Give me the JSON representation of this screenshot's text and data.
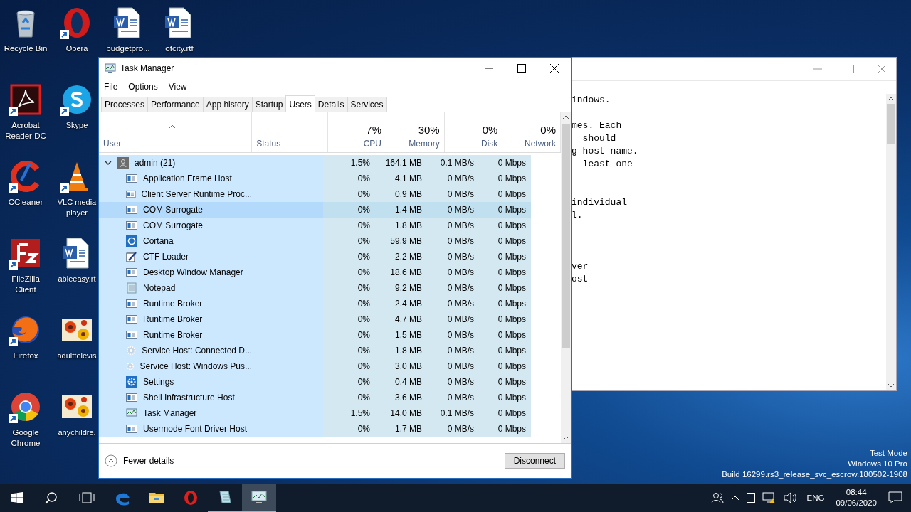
{
  "desktop_icons": [
    {
      "label": "Recycle Bin",
      "kind": "recycle",
      "shortcut": false
    },
    {
      "label": "Acrobat Reader DC",
      "kind": "acrobat",
      "shortcut": true
    },
    {
      "label": "CCleaner",
      "kind": "ccleaner",
      "shortcut": true
    },
    {
      "label": "FileZilla Client",
      "kind": "filezilla",
      "shortcut": true
    },
    {
      "label": "Firefox",
      "kind": "firefox",
      "shortcut": true
    },
    {
      "label": "Google Chrome",
      "kind": "chrome",
      "shortcut": true
    },
    {
      "label": "Opera",
      "kind": "opera",
      "shortcut": true
    },
    {
      "label": "Skype",
      "kind": "skype",
      "shortcut": true
    },
    {
      "label": "VLC media player",
      "kind": "vlc",
      "shortcut": true
    },
    {
      "label": "ableeasy.rt",
      "kind": "document",
      "shortcut": false
    },
    {
      "label": "adulttelevis",
      "kind": "image",
      "shortcut": false
    },
    {
      "label": "anychildre.",
      "kind": "image",
      "shortcut": false
    },
    {
      "label": "budgetpro...",
      "kind": "document",
      "shortcut": false
    },
    {
      "label": "ofcity.rtf",
      "kind": "document",
      "shortcut": false
    }
  ],
  "notepad_window": {
    "text": "indows.\n\nmes. Each\n  should\ng host name.\n  least one\n\n\nindividual\nl.\n\n\n\nver\nost"
  },
  "task_manager": {
    "title": "Task Manager",
    "menu": [
      "File",
      "Options",
      "View"
    ],
    "tabs": [
      {
        "label": "Processes",
        "selected": false
      },
      {
        "label": "Performance",
        "selected": false
      },
      {
        "label": "App history",
        "selected": false
      },
      {
        "label": "Startup",
        "selected": false
      },
      {
        "label": "Users",
        "selected": true
      },
      {
        "label": "Details",
        "selected": false
      },
      {
        "label": "Services",
        "selected": false
      }
    ],
    "columns": [
      {
        "label": "User"
      },
      {
        "label": "Status"
      },
      {
        "percent": "7%",
        "label": "CPU"
      },
      {
        "percent": "30%",
        "label": "Memory"
      },
      {
        "percent": "0%",
        "label": "Disk"
      },
      {
        "percent": "0%",
        "label": "Network"
      }
    ],
    "group": {
      "name": "admin (21)",
      "expanded": true,
      "cpu": "1.5%",
      "memory": "164.1 MB",
      "disk": "0.1 MB/s",
      "network": "0 Mbps"
    },
    "rows": [
      {
        "kind": "app",
        "name": "Application Frame Host",
        "cpu": "0%",
        "memory": "4.1 MB",
        "disk": "0 MB/s",
        "network": "0 Mbps",
        "selected": false
      },
      {
        "kind": "app",
        "name": "Client Server Runtime Proc...",
        "cpu": "0%",
        "memory": "0.9 MB",
        "disk": "0 MB/s",
        "network": "0 Mbps",
        "selected": false
      },
      {
        "kind": "app",
        "name": "COM Surrogate",
        "cpu": "0%",
        "memory": "1.4 MB",
        "disk": "0 MB/s",
        "network": "0 Mbps",
        "selected": true
      },
      {
        "kind": "app",
        "name": "COM Surrogate",
        "cpu": "0%",
        "memory": "1.8 MB",
        "disk": "0 MB/s",
        "network": "0 Mbps",
        "selected": false
      },
      {
        "kind": "cortana",
        "name": "Cortana",
        "cpu": "0%",
        "memory": "59.9 MB",
        "disk": "0 MB/s",
        "network": "0 Mbps",
        "selected": false
      },
      {
        "kind": "ctf",
        "name": "CTF Loader",
        "cpu": "0%",
        "memory": "2.2 MB",
        "disk": "0 MB/s",
        "network": "0 Mbps",
        "selected": false
      },
      {
        "kind": "app",
        "name": "Desktop Window Manager",
        "cpu": "0%",
        "memory": "18.6 MB",
        "disk": "0 MB/s",
        "network": "0 Mbps",
        "selected": false
      },
      {
        "kind": "notepad",
        "name": "Notepad",
        "cpu": "0%",
        "memory": "9.2 MB",
        "disk": "0 MB/s",
        "network": "0 Mbps",
        "selected": false
      },
      {
        "kind": "app",
        "name": "Runtime Broker",
        "cpu": "0%",
        "memory": "2.4 MB",
        "disk": "0 MB/s",
        "network": "0 Mbps",
        "selected": false
      },
      {
        "kind": "app",
        "name": "Runtime Broker",
        "cpu": "0%",
        "memory": "4.7 MB",
        "disk": "0 MB/s",
        "network": "0 Mbps",
        "selected": false
      },
      {
        "kind": "app",
        "name": "Runtime Broker",
        "cpu": "0%",
        "memory": "1.5 MB",
        "disk": "0 MB/s",
        "network": "0 Mbps",
        "selected": false
      },
      {
        "kind": "service",
        "name": "Service Host: Connected D...",
        "cpu": "0%",
        "memory": "1.8 MB",
        "disk": "0 MB/s",
        "network": "0 Mbps",
        "selected": false
      },
      {
        "kind": "service",
        "name": "Service Host: Windows Pus...",
        "cpu": "0%",
        "memory": "3.0 MB",
        "disk": "0 MB/s",
        "network": "0 Mbps",
        "selected": false
      },
      {
        "kind": "settings",
        "name": "Settings",
        "cpu": "0%",
        "memory": "0.4 MB",
        "disk": "0 MB/s",
        "network": "0 Mbps",
        "selected": false
      },
      {
        "kind": "app",
        "name": "Shell Infrastructure Host",
        "cpu": "0%",
        "memory": "3.6 MB",
        "disk": "0 MB/s",
        "network": "0 Mbps",
        "selected": false
      },
      {
        "kind": "taskmgr",
        "name": "Task Manager",
        "cpu": "1.5%",
        "memory": "14.0 MB",
        "disk": "0.1 MB/s",
        "network": "0 Mbps",
        "selected": false
      },
      {
        "kind": "app",
        "name": "Usermode Font Driver Host",
        "cpu": "0%",
        "memory": "1.7 MB",
        "disk": "0 MB/s",
        "network": "0 Mbps",
        "selected": false
      }
    ],
    "footer": {
      "toggle": "Fewer details",
      "button": "Disconnect"
    }
  },
  "desktop_notice": [
    "Test Mode",
    "Windows 10 Pro",
    "Build 16299.rs3_release_svc_escrow.180502-1908"
  ],
  "taskbar": {
    "apps": [
      {
        "kind": "edge",
        "running": false,
        "active": false
      },
      {
        "kind": "explorer",
        "running": false,
        "active": false
      },
      {
        "kind": "opera",
        "running": false,
        "active": false
      },
      {
        "kind": "notepad",
        "running": true,
        "active": false
      },
      {
        "kind": "taskmgr",
        "running": true,
        "active": true
      }
    ],
    "language": "ENG",
    "time": "08:44",
    "date": "09/06/2020"
  }
}
